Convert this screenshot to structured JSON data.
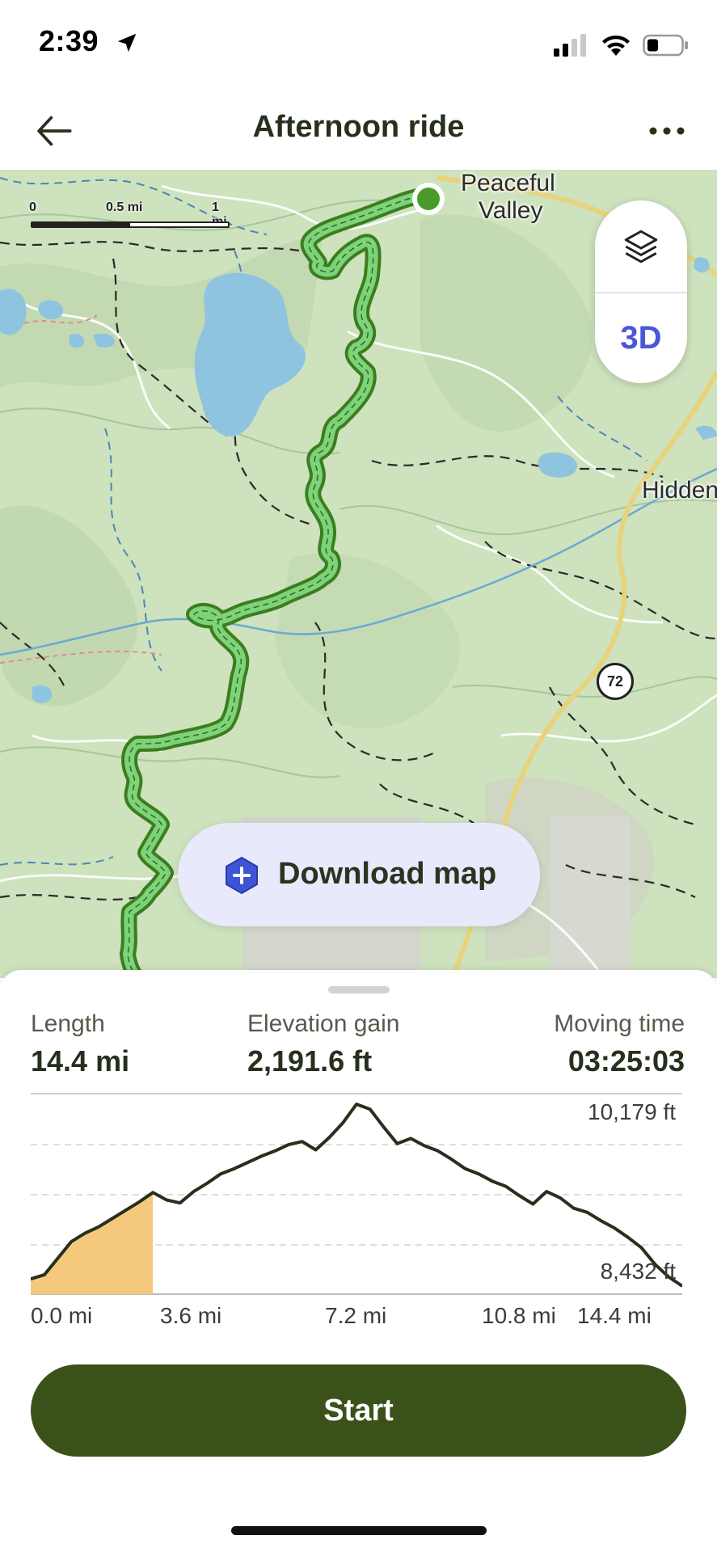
{
  "status_bar": {
    "time": "2:39",
    "icons": [
      "location-arrow-icon",
      "signal-icon",
      "wifi-icon",
      "battery-icon"
    ]
  },
  "header": {
    "title": "Afternoon ride",
    "back_icon": "arrow-left-icon",
    "more_icon": "more-horizontal-icon"
  },
  "map": {
    "scale": {
      "labels": [
        "0",
        "0.5 mi",
        "1 mi"
      ]
    },
    "place_labels": {
      "peaceful": "Peaceful",
      "valley": "Valley",
      "hidden": "Hidden"
    },
    "route_shield": "72",
    "layers_icon": "layers-icon",
    "toggle_3d": "3D",
    "download": {
      "label": "Download map",
      "icon": "hexagon-plus-icon"
    },
    "colors": {
      "route": "#7ed37a",
      "route_outline": "#3b7d1f",
      "start_marker": "#4a9a2a",
      "water": "#8fc4e0"
    }
  },
  "stats": {
    "length": {
      "label": "Length",
      "value": "14.4 mi"
    },
    "elevation_gain": {
      "label": "Elevation gain",
      "value": "2,191.6 ft"
    },
    "moving_time": {
      "label": "Moving time",
      "value": "03:25:03"
    }
  },
  "chart_data": {
    "type": "area",
    "ylabel_max": "10,179 ft",
    "ylabel_min": "8,432 ft",
    "ylim": [
      8432,
      10179
    ],
    "x_ticks": [
      "0.0 mi",
      "3.6 mi",
      "7.2 mi",
      "10.8 mi",
      "14.4 mi"
    ],
    "xlim": [
      0,
      14.4
    ],
    "highlight_range": [
      0,
      2.7
    ],
    "series": [
      {
        "x": [
          0,
          0.3,
          0.6,
          0.9,
          1.2,
          1.5,
          1.8,
          2.1,
          2.4,
          2.7,
          3.0,
          3.3,
          3.6,
          3.9,
          4.2,
          4.5,
          4.8,
          5.1,
          5.4,
          5.7,
          6.0,
          6.3,
          6.6,
          6.9,
          7.2,
          7.5,
          7.8,
          8.1,
          8.4,
          8.7,
          9.0,
          9.3,
          9.6,
          9.9,
          10.2,
          10.5,
          10.8,
          11.1,
          11.4,
          11.7,
          12.0,
          12.3,
          12.6,
          12.9,
          13.2,
          13.5,
          13.8,
          14.1,
          14.4
        ],
        "y": [
          8500,
          8540,
          8700,
          8860,
          8940,
          9000,
          9080,
          9160,
          9240,
          9330,
          9260,
          9230,
          9340,
          9420,
          9510,
          9560,
          9620,
          9680,
          9730,
          9790,
          9820,
          9740,
          9860,
          10000,
          10179,
          10130,
          9960,
          9800,
          9850,
          9780,
          9730,
          9650,
          9560,
          9510,
          9440,
          9390,
          9300,
          9220,
          9340,
          9280,
          9180,
          9140,
          9060,
          8990,
          8900,
          8800,
          8640,
          8520,
          8432
        ]
      }
    ]
  },
  "start_button": {
    "label": "Start"
  }
}
